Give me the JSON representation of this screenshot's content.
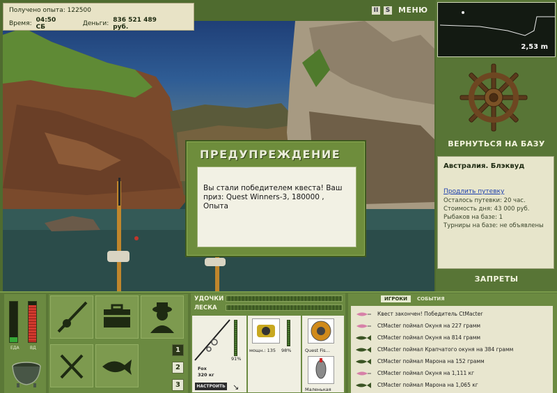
{
  "stats": {
    "exp_label": "Получено опыта:",
    "exp_value": "122500",
    "time_label": "Время:",
    "time_value": "04:50 СБ",
    "money_label": "Деньги:",
    "money_value": "836 521 489 руб."
  },
  "topbar": {
    "pause_glyph": "II",
    "sound_glyph": "S",
    "menu_label": "МЕНЮ"
  },
  "depth": {
    "value": "2,53 m"
  },
  "base": {
    "return_label": "ВЕРНУТЬСЯ НА БАЗУ",
    "name": "Австралия. Блэквуд",
    "extend_link": "Продлить путевку",
    "remaining": "Осталось путевки: 20 час.",
    "day_cost": "Стоимость дня: 43 000 руб.",
    "anglers": "Рыбаков на базе: 1",
    "tournaments": "Турниры на базе: не объявлены",
    "bans_label": "ЗАПРЕТЫ"
  },
  "dialog": {
    "title": "ПРЕДУПРЕЖДЕНИЕ",
    "message": "Вы стали победителем квеста! Ваш приз: Quest Winners-3, 180000 , Опыта"
  },
  "meters": {
    "food_label": "ЕДА",
    "food_level": 0.12,
    "drink_label": "ВД",
    "drink_level": 0.92
  },
  "slots": [
    "1",
    "2",
    "3"
  ],
  "tackle": {
    "rod_label": "УДОЧКИ",
    "line_label": "ЛЕСКА",
    "rod_name": "Fox",
    "rod_load": "320 кг",
    "rod_percent": "91%",
    "reel_name": "мощн.: 135",
    "reel_percent": "98%",
    "line_name": "Quest Fis...",
    "lure_name": "Маленькая",
    "config_label": "НАСТРОИТЬ"
  },
  "events": {
    "tabs": [
      "ИГРОКИ",
      "СОБЫТИЯ"
    ],
    "items": [
      {
        "text": "Квест закончен! Победитель CtMacter",
        "icon": "lure-icon"
      },
      {
        "text": "CtMacter поймал Окуня на 227 грамм",
        "icon": "lure-icon"
      },
      {
        "text": "CtMacter поймал Окуня на 814 грамм",
        "icon": "fish-icon"
      },
      {
        "text": "CtMacter поймал Крапчатого окуня на 384 грамм",
        "icon": "fish-icon"
      },
      {
        "text": "CtMacter поймал Марона на 152 грамм",
        "icon": "fish-icon"
      },
      {
        "text": "CtMacter поймал Окуня на 1,111 кг",
        "icon": "lure-icon"
      },
      {
        "text": "CtMacter поймал Марона на 1,065 кг",
        "icon": "fish-icon"
      }
    ]
  }
}
